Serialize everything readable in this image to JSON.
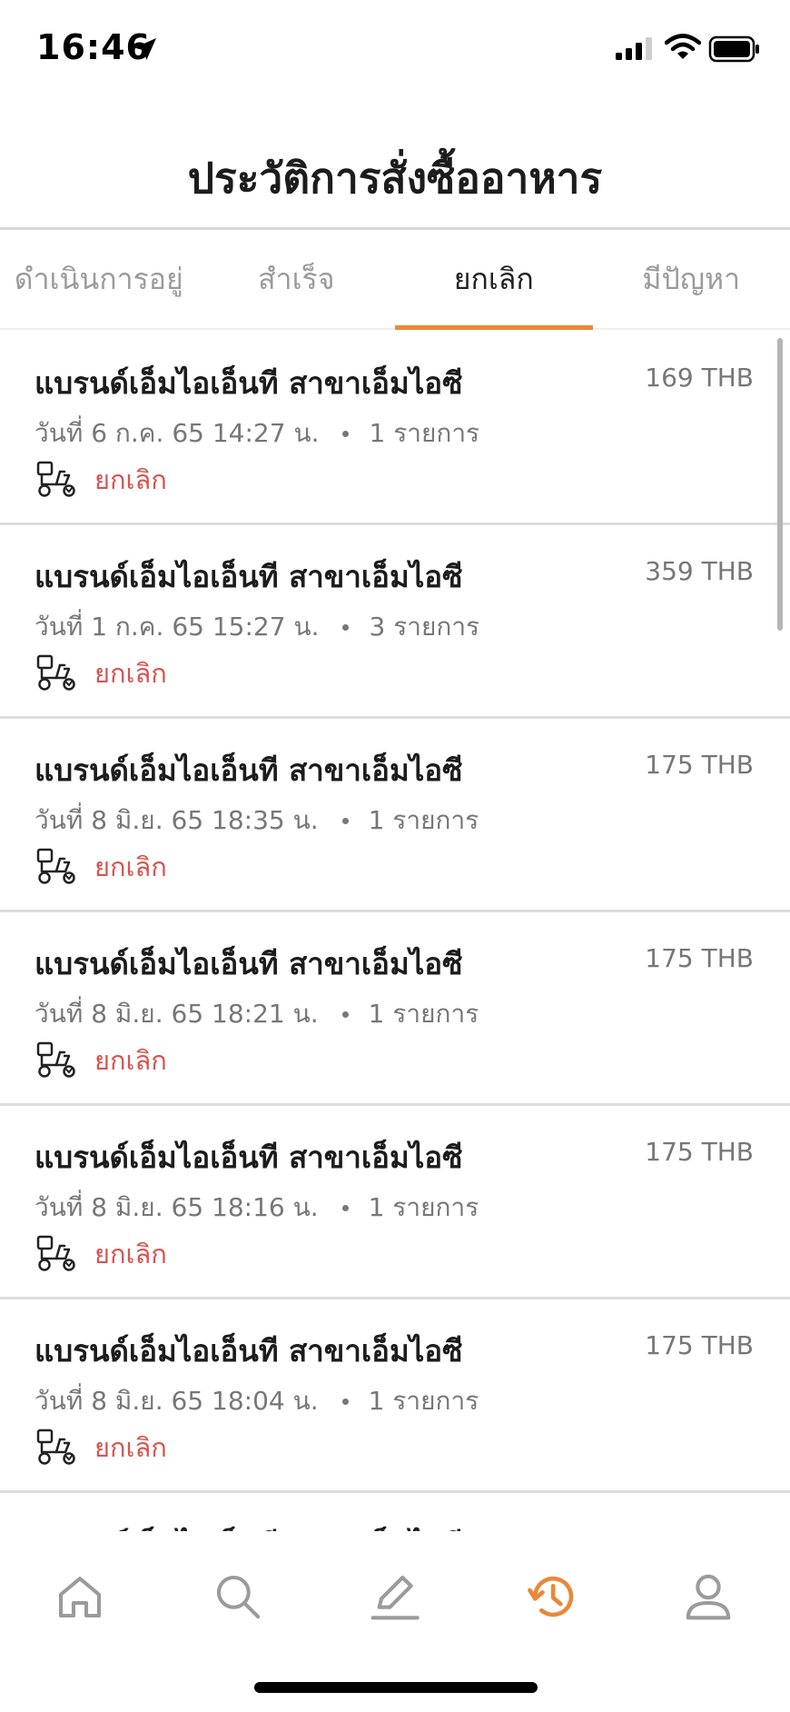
{
  "status_bar": {
    "time": "16:46",
    "icons": [
      "location-arrow-icon",
      "cellular-signal-icon",
      "wifi-icon",
      "battery-icon"
    ]
  },
  "header": {
    "title": "ประวัติการสั่งซื้ออาหาร"
  },
  "tabs": [
    {
      "label": "ดำเนินการอยู่",
      "active": false
    },
    {
      "label": "สำเร็จ",
      "active": false
    },
    {
      "label": "ยกเลิก",
      "active": true
    },
    {
      "label": "มีปัญหา",
      "active": false
    }
  ],
  "orders": [
    {
      "name": "แบรนด์เอ็มไอเอ็นที สาขาเอ็มไอซี",
      "price": "169 THB",
      "date": "วันที่ 6 ก.ค. 65 14:27 น.",
      "items": "1 รายการ",
      "status": "ยกเลิก"
    },
    {
      "name": "แบรนด์เอ็มไอเอ็นที สาขาเอ็มไอซี",
      "price": "359 THB",
      "date": "วันที่ 1 ก.ค. 65 15:27 น.",
      "items": "3 รายการ",
      "status": "ยกเลิก"
    },
    {
      "name": "แบรนด์เอ็มไอเอ็นที สาขาเอ็มไอซี",
      "price": "175 THB",
      "date": "วันที่ 8 มิ.ย. 65 18:35 น.",
      "items": "1 รายการ",
      "status": "ยกเลิก"
    },
    {
      "name": "แบรนด์เอ็มไอเอ็นที สาขาเอ็มไอซี",
      "price": "175 THB",
      "date": "วันที่ 8 มิ.ย. 65 18:21 น.",
      "items": "1 รายการ",
      "status": "ยกเลิก"
    },
    {
      "name": "แบรนด์เอ็มไอเอ็นที สาขาเอ็มไอซี",
      "price": "175 THB",
      "date": "วันที่ 8 มิ.ย. 65 18:16 น.",
      "items": "1 รายการ",
      "status": "ยกเลิก"
    },
    {
      "name": "แบรนด์เอ็มไอเอ็นที สาขาเอ็มไอซี",
      "price": "175 THB",
      "date": "วันที่ 8 มิ.ย. 65 18:04 น.",
      "items": "1 รายการ",
      "status": "ยกเลิก"
    },
    {
      "name": "แบรนด์เอ็มไอเอ็นที สาขาเอ็มไอซี",
      "price": "",
      "date": "",
      "items": "",
      "status": ""
    }
  ],
  "bottom_nav": [
    {
      "icon": "home-icon",
      "active": false
    },
    {
      "icon": "search-icon",
      "active": false
    },
    {
      "icon": "edit-icon",
      "active": false
    },
    {
      "icon": "history-icon",
      "active": true
    },
    {
      "icon": "profile-icon",
      "active": false
    }
  ],
  "colors": {
    "accent": "#e8893a",
    "cancel_status": "#d9534f",
    "inactive_icon": "#9b9b9b"
  }
}
